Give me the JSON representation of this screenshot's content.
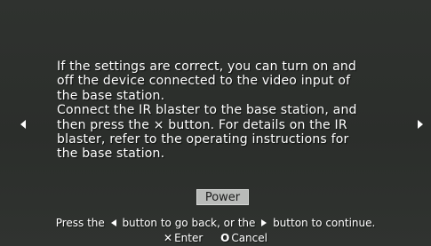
{
  "instructions": {
    "lines": [
      "If the settings are correct, you can turn on and",
      "off the device connected to the video input of",
      "the base station.",
      "Connect the IR blaster to the base station, and",
      "then press the × button. For details on the IR",
      "blaster, refer to the operating instructions for",
      "the base station."
    ]
  },
  "power_button": {
    "label": "Power"
  },
  "help": {
    "prefix": "Press the",
    "middle": "button to go back, or the",
    "suffix": "button to continue."
  },
  "controls": {
    "enter": {
      "glyph": "✕",
      "label": "Enter"
    },
    "cancel": {
      "glyph": "O",
      "label": "Cancel"
    }
  },
  "icons": {
    "nav_left": "arrow-left-icon",
    "nav_right": "arrow-right-icon",
    "cross": "cross-button-icon",
    "circle": "circle-button-icon"
  },
  "colors": {
    "background": "#2c2f2c",
    "text": "#ffffff",
    "button_bg": "#b9bbb9",
    "button_text": "#1c1c1c"
  }
}
